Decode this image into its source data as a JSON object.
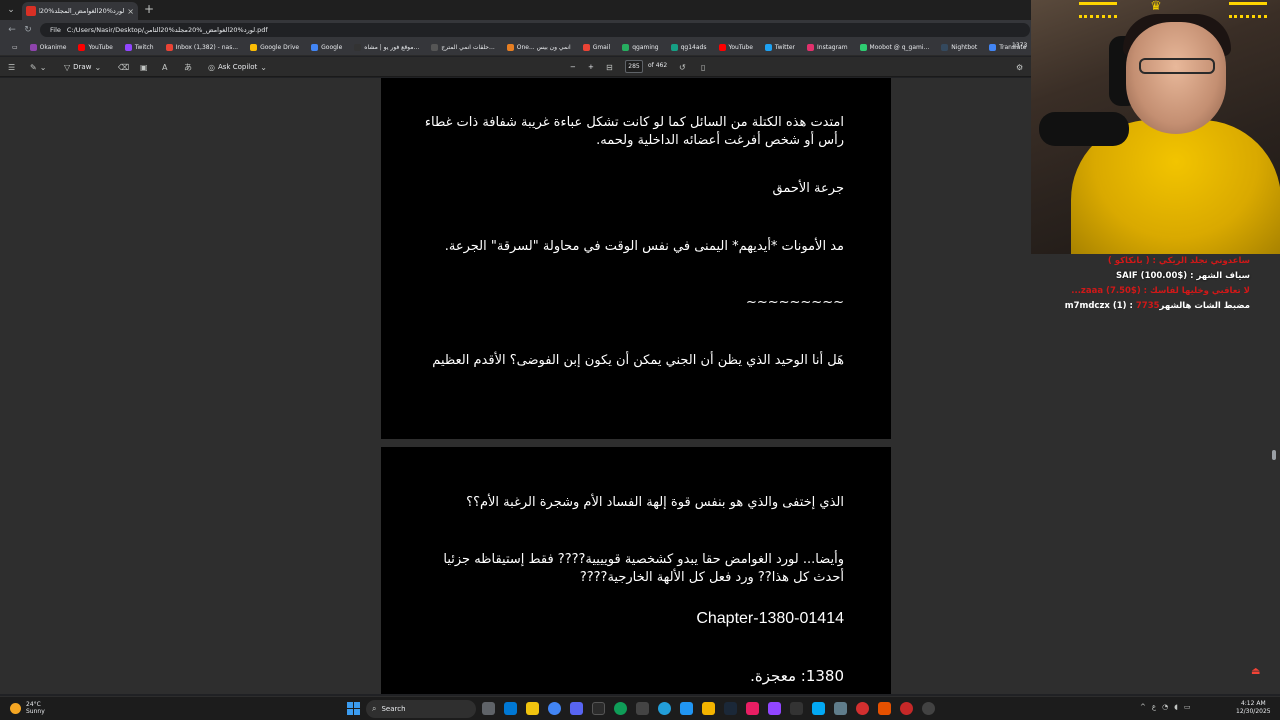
{
  "browser": {
    "tab_title": "لورد%20الغوامض_المجلد%20الثامن.pdf",
    "new_tab_symbol": "+",
    "close_symbol": "×",
    "url_scheme_label": "File",
    "url": "C:/Users/Nasir/Desktop/لورد%20الغوامض_%20مجلد%20الثامن.pdf"
  },
  "bookmarks": [
    {
      "label": "Okanime",
      "color": "#8e44ad"
    },
    {
      "label": "YouTube",
      "color": "#ff0000"
    },
    {
      "label": "Twitch",
      "color": "#9146ff"
    },
    {
      "label": "Inbox (1,382) - nas...",
      "color": "#ea4335"
    },
    {
      "label": "Google Drive",
      "color": "#fbbc04"
    },
    {
      "label": "Google",
      "color": "#4285f4"
    },
    {
      "label": "موقع فور يو | مشاه...",
      "color": "#333333"
    },
    {
      "label": "حلقات انمي المترج...",
      "color": "#555555"
    },
    {
      "label": "One... انمي ون بيس",
      "color": "#e67e22"
    },
    {
      "label": "Gmail",
      "color": "#ea4335"
    },
    {
      "label": "qgaming",
      "color": "#27ae60"
    },
    {
      "label": "qg14ads",
      "color": "#16a085"
    },
    {
      "label": "YouTube",
      "color": "#ff0000"
    },
    {
      "label": "Twitter",
      "color": "#1da1f2"
    },
    {
      "label": "Instagram",
      "color": "#e1306c"
    },
    {
      "label": "Moobot @ q_gami...",
      "color": "#2ecc71"
    },
    {
      "label": "Nightbot",
      "color": "#34495e"
    },
    {
      "label": "Translate",
      "color": "#4285f4"
    }
  ],
  "bookmark_overflow_count": "1373",
  "pdf_toolbar": {
    "draw_label": "Draw",
    "copilot_label": "Ask Copilot",
    "zoom_out": "−",
    "zoom_in": "+",
    "page_current": "285",
    "page_total": "of 462"
  },
  "document": {
    "page1": [
      "امتدت هذه الكتلة من السائل كما لو كانت تشكل عباءة غريبة شفافة ذات غطاء رأس أو شخص أفرغت أعضائه الداخلية ولحمه.",
      "جرعة الأحمق",
      "مد الأمونات *أيديهم* اليمنى في نفس الوقت في محاولة \"لسرقة\" الجرعة.",
      "~~~~~~~~~",
      "هَل أنا الوحيد الذي يظن أن الجني يمكن أن يكون إبن الفوضى؟ الأقدم العظيم"
    ],
    "page2": [
      "الذي إختفى والذي هو بنفس قوة إلهة الفساد الأم وشجرة الرغبة الأم؟؟",
      "وأيضا... لورد الغوامض حقا يبدو كشخصية قويييية???? فقط إستيقاظه جزئيا أحدث كل هذا?? ورد فعل كل الألهة الخارجية????",
      "Chapter-1380-01414",
      "1380: معجزة."
    ]
  },
  "stream_overlay": {
    "line1": "ساعدوني نجلد الريكي : ( بانكاكو )",
    "line2": "سياف الشهر : ($100.00) SAIF",
    "line3_red": "لا تعاقبي وخليها لفاسك : ($7.50) zaaa...",
    "line4_name": "m7mdczx (1) : ",
    "line4_label": "مضبط الشات هالشهر",
    "line4_prefix": "7735"
  },
  "taskbar": {
    "weather_temp": "24°C",
    "weather_desc": "Sunny",
    "search_label": "Search",
    "time": "4:12 AM",
    "date": "12/30/2025",
    "lang": "ع"
  }
}
